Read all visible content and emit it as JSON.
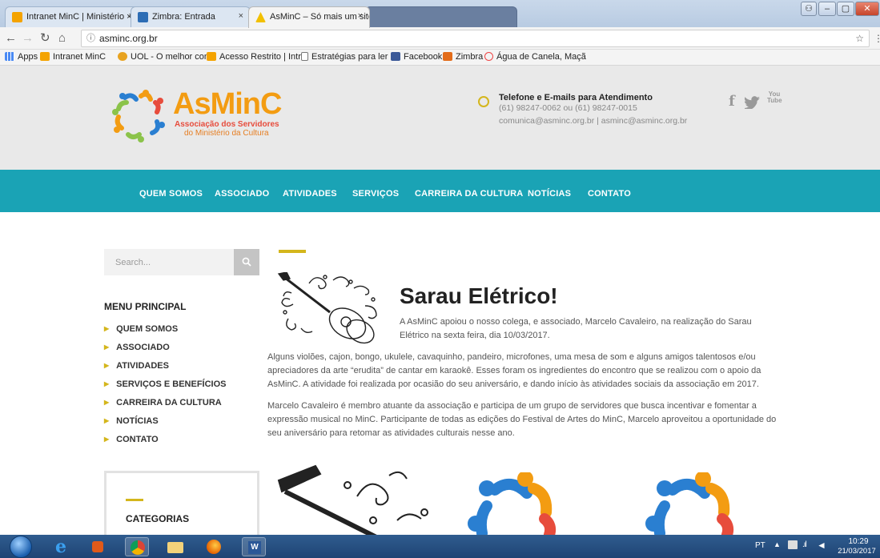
{
  "browser": {
    "tabs": [
      {
        "title": "Intranet MinC | Ministério ×",
        "active": false
      },
      {
        "title": "Zimbra: Entrada",
        "active": false
      },
      {
        "title": "AsMinC – Só mais um site",
        "active": true
      },
      {
        "title": "",
        "active": false
      }
    ],
    "url": "asminc.org.br",
    "bookmarks": [
      "Apps",
      "Intranet MinC",
      "UOL - O melhor conte",
      "Acesso Restrito | Intra",
      "Estratégias para ler m",
      "Facebook",
      "Zimbra",
      "Água de Canela, Maçã"
    ]
  },
  "header": {
    "logo_main": "AsMinC",
    "logo_sub1": "Associação dos Servidores",
    "logo_sub2": "do Ministério da Cultura",
    "contact_title": "Telefone e E-mails para Atendimento",
    "contact_phones": "(61) 98247-0062 ou (61) 98247-0015",
    "contact_emails": "comunica@asminc.org.br | asminc@asminc.org.br",
    "social": [
      "f",
      "t",
      "You Tube"
    ]
  },
  "nav": [
    "QUEM SOMOS",
    "ASSOCIADO",
    "ATIVIDADES",
    "SERVIÇOS",
    "CARREIRA DA CULTURA",
    "NOTÍCIAS",
    "CONTATO"
  ],
  "sidebar": {
    "search_placeholder": "Search...",
    "menu_title": "MENU PRINCIPAL",
    "menu": [
      "QUEM SOMOS",
      "ASSOCIADO",
      "ATIVIDADES",
      "SERVIÇOS E BENEFÍCIOS",
      "CARREIRA DA CULTURA",
      "NOTÍCIAS",
      "CONTATO"
    ],
    "categories_title": "CATEGORIAS"
  },
  "post": {
    "title": "Sarau Elétrico!",
    "intro": "A AsMinC apoiou o nosso colega, e associado, Marcelo Cavaleiro, na realização do Sarau Elétrico na sexta feira, dia 10/03/2017.",
    "p1": "Alguns violões, cajon, bongo, ukulele, cavaquinho, pandeiro, microfones, uma mesa de som e alguns amigos talentosos e/ou apreciadores da arte “erudita” de cantar em karaokê. Esses foram os ingredientes do encontro que se realizou com o apoio da AsMinC. A atividade foi realizada por ocasião do seu aniversário, e dando início às atividades sociais da associação em 2017.",
    "p2": "Marcelo Cavaleiro é membro atuante da associação e participa de um grupo de servidores que busca incentivar e fomentar a expressão musical no MinC. Participante de todas as edições do Festival de Artes do MinC, Marcelo aproveitou a oportunidade do seu aniversário para retomar as atividades culturais nesse ano."
  },
  "taskbar": {
    "lang": "PT",
    "time": "10:29",
    "date": "21/03/2017"
  },
  "colors": {
    "teal": "#1aa3b5",
    "gold": "#d4b61c",
    "orange": "#f39c12",
    "blue": "#2a7fd1"
  }
}
